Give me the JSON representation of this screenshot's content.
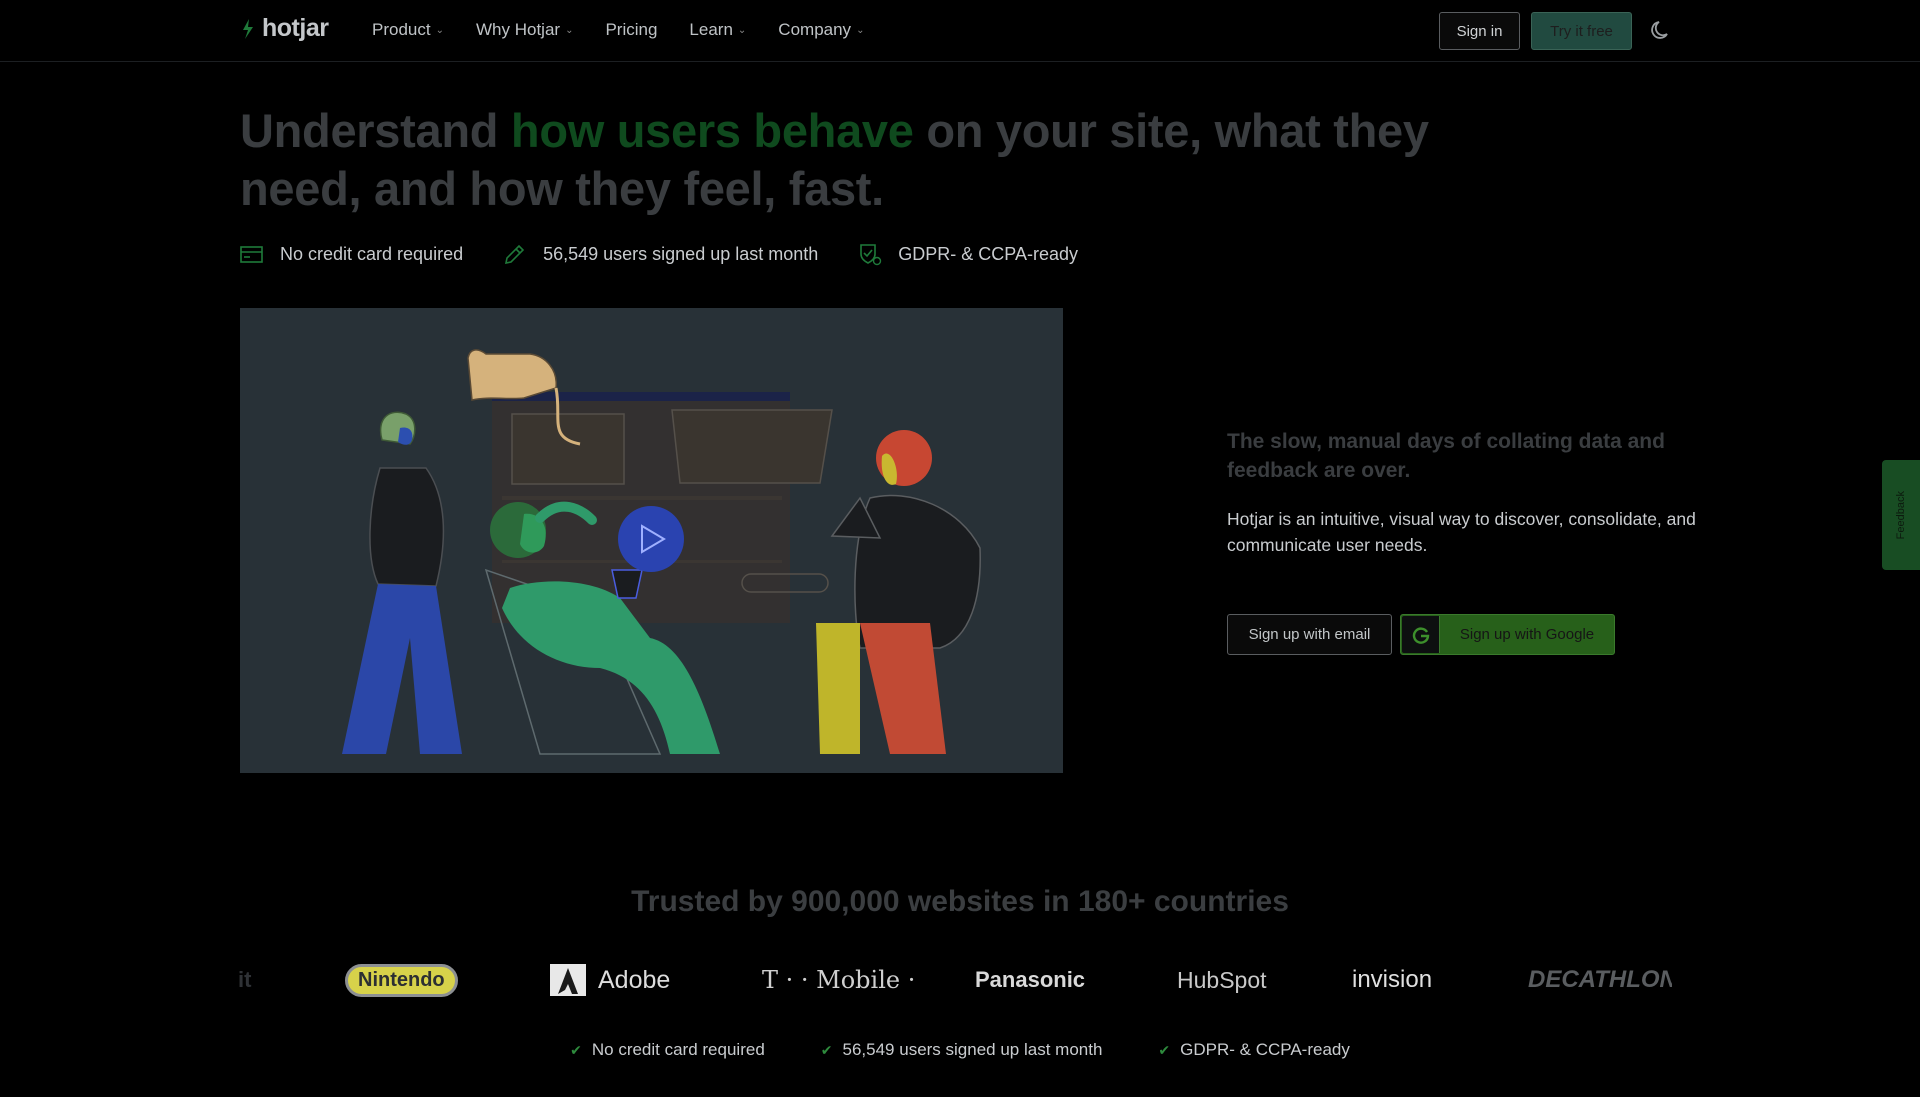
{
  "nav": {
    "brand": "hotjar",
    "items": [
      {
        "label": "Product",
        "has_dropdown": true
      },
      {
        "label": "Why Hotjar",
        "has_dropdown": true
      },
      {
        "label": "Pricing",
        "has_dropdown": false
      },
      {
        "label": "Learn",
        "has_dropdown": true
      },
      {
        "label": "Company",
        "has_dropdown": true
      }
    ],
    "sign_in": "Sign in",
    "try_free": "Try it free",
    "theme_icon": "moon-icon"
  },
  "hero": {
    "headline_pre": "Understand ",
    "headline_highlight": "how users behave",
    "headline_post": " on your site, what they need, and how they feel, fast.",
    "features": [
      {
        "icon": "credit-card-icon",
        "label": "No credit card required"
      },
      {
        "icon": "pencil-icon",
        "label": "56,549 users signed up last month"
      },
      {
        "icon": "shield-check-icon",
        "label": "GDPR- & CCPA-ready"
      }
    ],
    "video_icon": "play-icon",
    "side_title": "The slow, manual days of collating data and feedback are over.",
    "side_body": "Hotjar is an intuitive, visual way to discover, consolidate, and communicate user needs.",
    "signup_email": "Sign up with email",
    "signup_google": "Sign up with Google"
  },
  "feedback_tab": {
    "label": "Feedback"
  },
  "trust": {
    "title": "Trusted by 900,000 websites in 180+ countries",
    "logos": [
      "it",
      "Nintendo",
      "Adobe",
      "T · · Mobile ·",
      "Panasonic",
      "HubSpot",
      "invision",
      "DECATHLON"
    ],
    "bottom_features": [
      {
        "icon": "check-icon",
        "label": "No credit card required"
      },
      {
        "icon": "check-icon",
        "label": "56,549 users signed up last month"
      },
      {
        "icon": "check-icon",
        "label": "GDPR- & CCPA-ready"
      }
    ]
  },
  "colors": {
    "background": "#000000",
    "brand_green": "#0f4a1e",
    "button_green": "#27601a",
    "try_button": "#214a40",
    "video_bg": "#283137"
  }
}
